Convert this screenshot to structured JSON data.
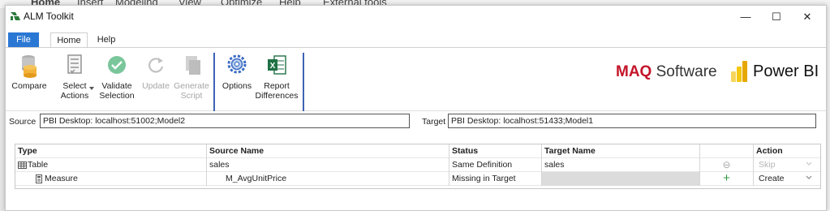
{
  "background_menu": [
    "Home",
    "Insert",
    "Modeling",
    "View",
    "Optimize",
    "Help",
    "External tools"
  ],
  "window": {
    "title": "ALM Toolkit",
    "minimize": "—",
    "maximize": "☐",
    "close": "✕"
  },
  "ribbon_tabs": [
    "File",
    "Home",
    "Help"
  ],
  "ribbon": {
    "compare": "Compare",
    "select_actions_1": "Select",
    "select_actions_2": "Actions",
    "validate_1": "Validate",
    "validate_2": "Selection",
    "update": "Update",
    "generate_1": "Generate",
    "generate_2": "Script",
    "options": "Options",
    "report_1": "Report",
    "report_2": "Differences"
  },
  "branding": {
    "maq_bold": "MAQ",
    "maq_rest": " Software",
    "powerbi": "Power BI",
    "maq_color": "#c4142a",
    "powerbi_color": "#f2c811"
  },
  "connection": {
    "source_label": "Source",
    "source_value": "PBI Desktop: localhost:51002;Model2",
    "target_label": "Target",
    "target_value": "PBI Desktop: localhost:51433;Model1"
  },
  "grid": {
    "columns": [
      "Type",
      "Source Name",
      "Status",
      "Target Name",
      "",
      "Action"
    ],
    "rows": [
      {
        "type": "Table",
        "source": "sales",
        "status": "Same Definition",
        "target": "sales",
        "icon": "⊖",
        "action": "Skip"
      },
      {
        "type": "Measure",
        "source": "M_AvgUnitPrice",
        "status": "Missing in Target",
        "target": "",
        "icon": "+",
        "action": "Create"
      }
    ]
  },
  "colors": {
    "file_tab": "#2b78d4",
    "separator": "#3f63b5",
    "create_icon": "#2e9b3e"
  }
}
